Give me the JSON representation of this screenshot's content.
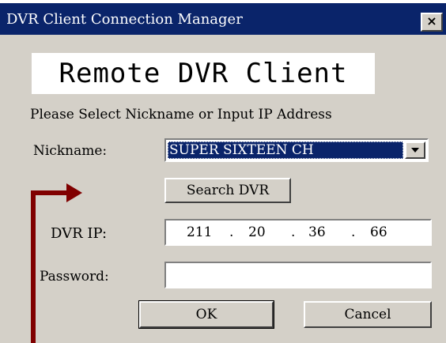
{
  "window": {
    "title": "DVR Client Connection Manager",
    "close_label": "×"
  },
  "banner": {
    "text": "Remote DVR Client"
  },
  "form": {
    "instruction": "Please Select Nickname or Input IP Address",
    "nickname_label": "Nickname:",
    "nickname_value": "SUPER SIXTEEN CH",
    "search_button": "Search DVR",
    "dvr_ip_label": "DVR IP:",
    "ip_octets": [
      "211",
      "20",
      "36",
      "66"
    ],
    "ip_separator": ".",
    "password_label": "Password:",
    "password_value": "",
    "ok_button": "OK",
    "cancel_button": "Cancel"
  },
  "annotation": {
    "arrow_color": "#800000"
  },
  "colors": {
    "titlebar": "#0a246a",
    "dialog_face": "#d4d0c8",
    "selection": "#0a246a"
  }
}
